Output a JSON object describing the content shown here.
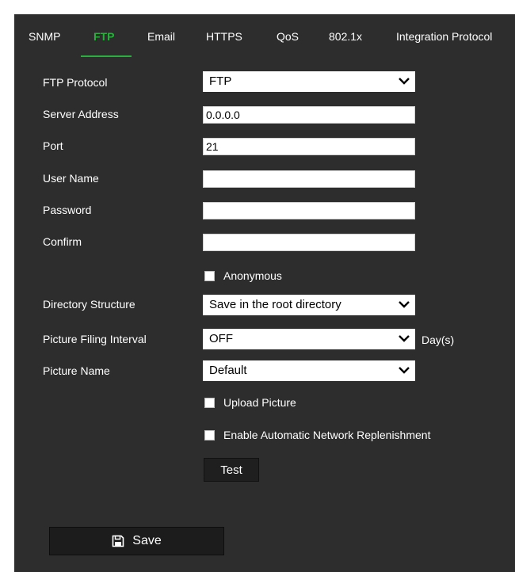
{
  "tabs": [
    {
      "label": "SNMP"
    },
    {
      "label": "FTP",
      "active": true
    },
    {
      "label": "Email"
    },
    {
      "label": "HTTPS"
    },
    {
      "label": "QoS"
    },
    {
      "label": "802.1x"
    },
    {
      "label": "Integration Protocol"
    }
  ],
  "form": {
    "ftp_protocol": {
      "label": "FTP Protocol",
      "value": "FTP"
    },
    "server_address": {
      "label": "Server Address",
      "value": "0.0.0.0"
    },
    "port": {
      "label": "Port",
      "value": "21"
    },
    "user_name": {
      "label": "User Name",
      "value": ""
    },
    "password": {
      "label": "Password",
      "value": ""
    },
    "confirm": {
      "label": "Confirm",
      "value": ""
    },
    "anonymous": {
      "label": "Anonymous",
      "checked": false
    },
    "directory_structure": {
      "label": "Directory Structure",
      "value": "Save in the root directory"
    },
    "picture_filing_interval": {
      "label": "Picture Filing Interval",
      "value": "OFF",
      "unit": "Day(s)"
    },
    "picture_name": {
      "label": "Picture Name",
      "value": "Default"
    },
    "upload_picture": {
      "label": "Upload Picture",
      "checked": false
    },
    "auto_replenishment": {
      "label": "Enable Automatic Network Replenishment",
      "checked": false
    }
  },
  "buttons": {
    "test": "Test",
    "save": "Save"
  },
  "colors": {
    "panel_bg": "#2d2d2d",
    "accent": "#2cae3f",
    "text": "#ffffff"
  },
  "icons": {
    "save": "floppy-disk-icon",
    "dropdown": "chevron-down-icon"
  }
}
